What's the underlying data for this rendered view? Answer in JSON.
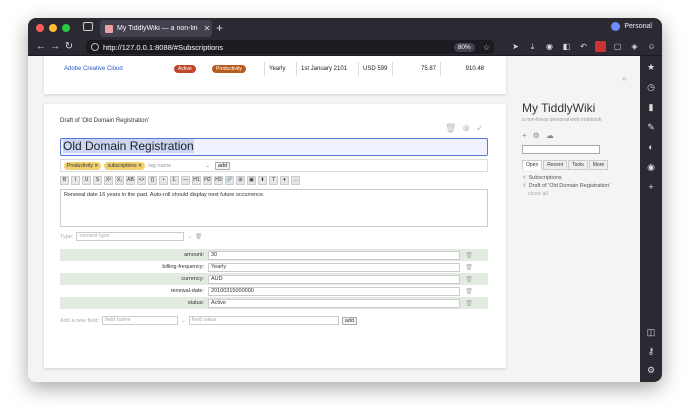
{
  "browser": {
    "tab_title": "My TiddlyWiki — a non-linear personal web notebook",
    "url": "http://127.0.0.1:8088/#Subscriptions",
    "zoom": "80%",
    "profile_label": "Personal"
  },
  "subscription_row": {
    "name": "Adobe Creative Cloud",
    "status": "Active",
    "category": "Productivity",
    "frequency": "Yearly",
    "renewal": "1st January 2101",
    "currency_amount": "USD 599",
    "col_a": "75.87",
    "col_b": "910.48",
    "colors": {
      "status": "#c0472c",
      "category": "#b85c1c"
    }
  },
  "draft": {
    "label": "Draft of 'Old Domain Registration'",
    "title": "Old Domain Registration",
    "tags": [
      "Productivity",
      "subscriptions"
    ],
    "tag_placeholder": "tag name",
    "add_label": "add",
    "body": "Renewal date 16 years in the past. Auto-roll should display next future occurrence.",
    "type_label": "Type:",
    "type_placeholder": "content type",
    "fields": [
      {
        "name": "amount:",
        "value": "30"
      },
      {
        "name": "billing-frequency:",
        "value": "Yearly"
      },
      {
        "name": "currency:",
        "value": "AUD"
      },
      {
        "name": "renewal-date:",
        "value": "20100315000000"
      },
      {
        "name": "status:",
        "value": "Active"
      }
    ],
    "new_field_label": "Add a new field:",
    "field_name_placeholder": "field name",
    "field_value_placeholder": "field value"
  },
  "toolbar_buttons": [
    "B",
    "I",
    "U",
    "S",
    "X²",
    "X₂",
    "AB",
    "<>",
    "{}",
    "•",
    "1.",
    "—",
    "H1",
    "H2",
    "H3",
    "🔗",
    "⊞",
    "▣",
    "⬆",
    "T",
    "▾",
    "…"
  ],
  "sidebar": {
    "title": "My TiddlyWiki",
    "subtitle": "a non-linear personal web notebook",
    "tabs": [
      "Open",
      "Recent",
      "Tools",
      "More"
    ],
    "open_items": [
      "Subscriptions",
      "Draft of 'Old Domain Registration'"
    ],
    "close_all": "close all"
  }
}
